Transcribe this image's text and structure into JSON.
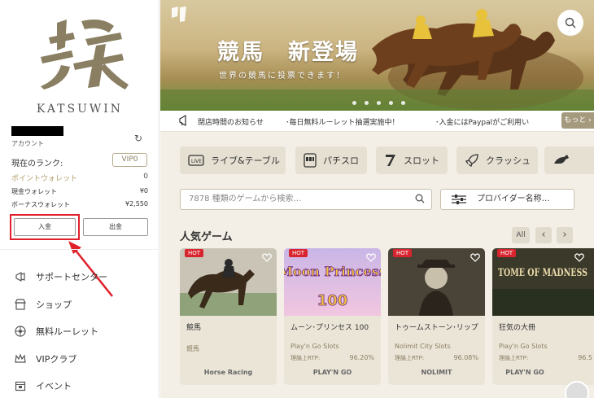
{
  "sidebar": {
    "brand": "KATSUWIN",
    "account_label": "アカウント",
    "rank_label": "現在のランク:",
    "rank_value": "VIP0",
    "point_wallet_label": "ポイントウォレット",
    "point_wallet_value": "0",
    "cash_wallet_label": "現金ウォレット",
    "cash_wallet_value": "¥0",
    "bonus_wallet_label": "ボーナスウォレット",
    "bonus_wallet_value": "¥2,550",
    "deposit_label": "入金",
    "withdraw_label": "出金",
    "nav": [
      {
        "label": "サポートセンター",
        "icon": "megaphone-icon"
      },
      {
        "label": "ショップ",
        "icon": "shop-icon"
      },
      {
        "label": "無料ルーレット",
        "icon": "roulette-icon"
      },
      {
        "label": "VIPクラブ",
        "icon": "crown-icon"
      },
      {
        "label": "イベント",
        "icon": "calendar-icon"
      }
    ],
    "highlight_color": "#e0202a"
  },
  "banner": {
    "title": "競馬　新登場",
    "subtitle": "世界の競馬に投票できます！"
  },
  "ticker": {
    "items": [
      "閉店時間のお知らせ",
      "･毎日無料ルーレット抽選実施中！",
      "･入金にはPaypalがご利用い"
    ],
    "more_label": "もっと ›"
  },
  "categories": [
    {
      "label": "ライブ&テーブル",
      "icon": "live-icon"
    },
    {
      "label": "パチスロ",
      "icon": "slot-machine-icon"
    },
    {
      "label": "スロット",
      "icon": "seven-icon"
    },
    {
      "label": "クラッシュ",
      "icon": "rocket-icon"
    },
    {
      "label": "",
      "icon": "horse-icon"
    }
  ],
  "search": {
    "placeholder": "7878 種類のゲームから検索…",
    "provider_label": "プロバイダー名称…"
  },
  "popular": {
    "title": "人気ゲーム",
    "all_label": "All",
    "prev_label": "‹",
    "next_label": "›",
    "rtp_label": "理論上RTP:",
    "hot_label": "HOT",
    "games": [
      {
        "name": "競馬",
        "provider": "競馬",
        "rtp": "",
        "provider_logo": "Horse Racing"
      },
      {
        "name": "ムーン･プリンセス 100",
        "provider": "Play'n Go Slots",
        "rtp": "96.20%",
        "provider_logo": "PLAY'N GO",
        "art_title": "Moon Princess",
        "art_num": "100"
      },
      {
        "name": "トゥームストーン･リップ",
        "provider": "Nolimit City Slots",
        "rtp": "96.08%",
        "provider_logo": "NOLIMIT"
      },
      {
        "name": "狂気の大冊",
        "provider": "Play'n Go Slots",
        "rtp": "96.5",
        "provider_logo": "PLAY'N GO",
        "art_title": "TOME OF MADNESS"
      }
    ]
  }
}
